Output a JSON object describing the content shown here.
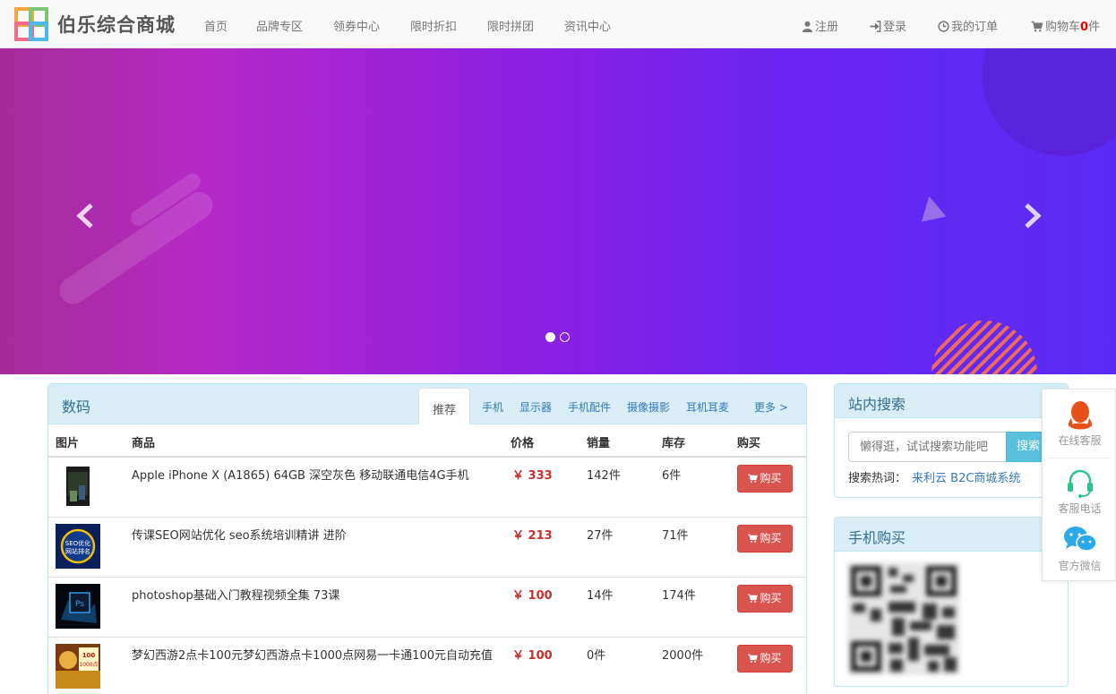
{
  "brand": {
    "name": "伯乐综合商城"
  },
  "nav": {
    "left": [
      "首页",
      "品牌专区",
      "领券中心",
      "限时折扣",
      "限时拼团",
      "资讯中心"
    ],
    "register": "注册",
    "login": "登录",
    "orders": "我的订单",
    "cart_prefix": "购物车",
    "cart_count": "0",
    "cart_suffix": "件"
  },
  "banner": {
    "slides_total": 2,
    "active_slide": 1
  },
  "digital": {
    "title": "数码",
    "tabs": [
      "推荐",
      "手机",
      "显示器",
      "手机配件",
      "摄像摄影",
      "耳机耳麦",
      "更多 >"
    ],
    "columns": [
      "图片",
      "商品",
      "价格",
      "销量",
      "库存",
      "购买"
    ],
    "buy_label": "购买",
    "products": [
      {
        "name": "Apple iPhone X (A1865) 64GB 深空灰色 移动联通电信4G手机",
        "price": "￥ 333",
        "sales": "142件",
        "stock": "6件",
        "thumb_text": ""
      },
      {
        "name": "传课SEO网站优化 seo系统培训精讲 进阶",
        "price": "￥ 213",
        "sales": "27件",
        "stock": "71件",
        "thumb_text": "SEO优化 网站排名"
      },
      {
        "name": "photoshop基础入门教程视频全集 73课",
        "price": "￥ 100",
        "sales": "14件",
        "stock": "174件",
        "thumb_text": "Ps"
      },
      {
        "name": "梦幻西游2点卡100元梦幻西游点卡1000点网易一卡通100元自动充值",
        "price": "￥ 100",
        "sales": "0件",
        "stock": "2000件",
        "thumb_text": "100 1000点"
      }
    ]
  },
  "search": {
    "title": "站内搜索",
    "placeholder": "懒得逛，试试搜索功能吧",
    "button": "搜索",
    "hot_label": "搜索热词：",
    "hot_words": [
      "来利云 B2C商城系统"
    ]
  },
  "mobile": {
    "title": "手机购买"
  },
  "service": {
    "online": "在线客服",
    "phone": "客服电话",
    "wechat": "官方微信"
  },
  "colors": {
    "price": "#c9302c",
    "buy_button": "#d9534f",
    "panel_head": "#d9edf7",
    "search_button": "#5bc0de"
  }
}
